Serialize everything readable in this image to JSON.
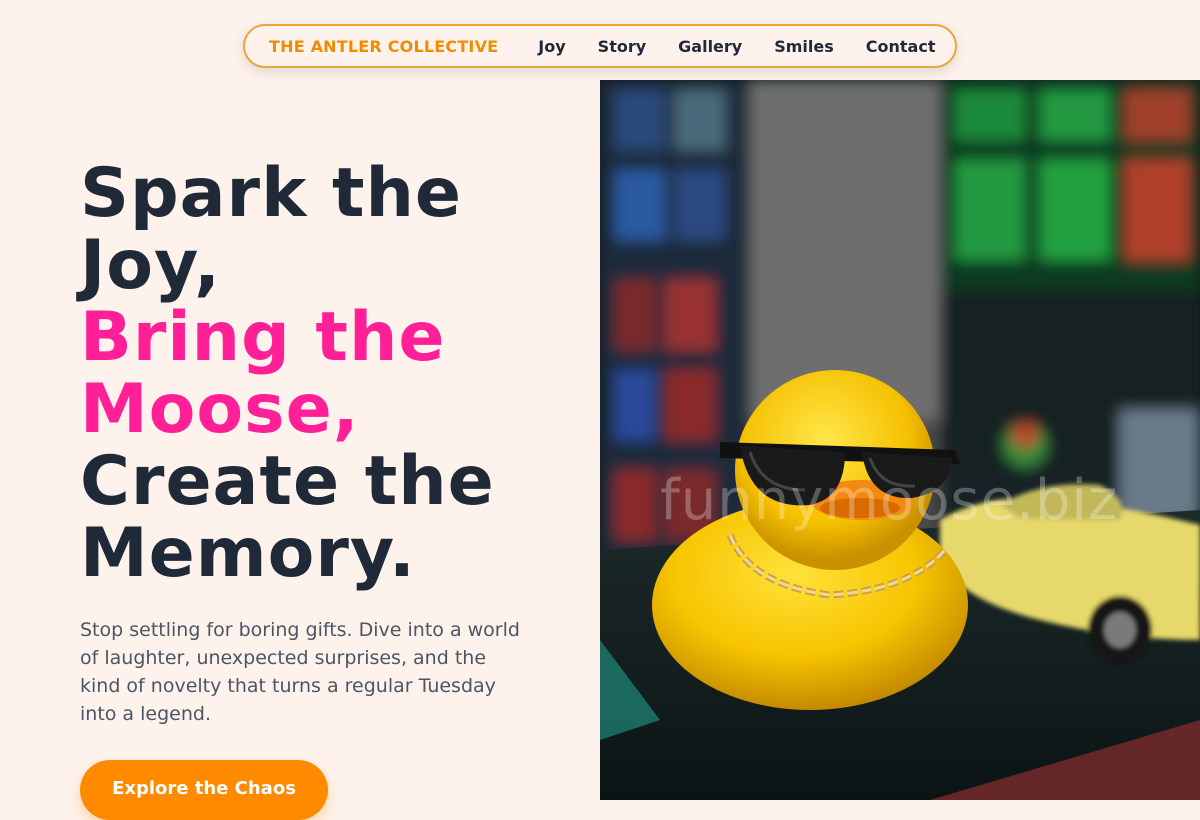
{
  "nav": {
    "brand": "THE ANTLER COLLECTIVE",
    "links": [
      "Joy",
      "Story",
      "Gallery",
      "Smiles",
      "Contact"
    ]
  },
  "hero": {
    "headline_line1": "Spark the",
    "headline_line2": "Joy,",
    "headline_line3": "Bring the",
    "headline_line4": "Moose,",
    "headline_line5": "Create the",
    "headline_line6": "Memory.",
    "description": "Stop settling for boring gifts. Dive into a world of laughter, unexpected surprises, and the kind of novelty that turns a regular Tuesday into a legend.",
    "cta_label": "Explore the Chaos"
  },
  "photo": {
    "watermark": "funnymoose.biz",
    "subject": "rubber-duck-with-sunglasses-and-gold-chain"
  },
  "colors": {
    "background": "#fdf3ec",
    "brand_orange": "#f08c00",
    "accent_pink": "#ff1f96",
    "text_dark": "#1f2937",
    "cta_orange": "#ff8a00"
  }
}
